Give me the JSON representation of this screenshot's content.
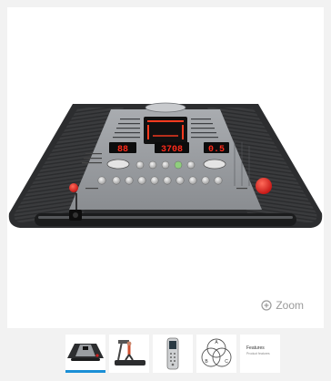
{
  "viewer": {
    "zoom_label": "Zoom",
    "zoom_icon": "zoom-icon",
    "console": {
      "left_display": "88",
      "center_display": "3708",
      "right_display": "0.5"
    }
  },
  "thumbnails": [
    {
      "name": "thumb-console",
      "active": true
    },
    {
      "name": "thumb-treadmill",
      "active": false
    },
    {
      "name": "thumb-remote",
      "active": false
    },
    {
      "name": "thumb-venn",
      "active": false,
      "letters": [
        "A",
        "B",
        "C"
      ]
    },
    {
      "name": "thumb-features",
      "active": false,
      "title": "Features",
      "subtitle": "Product features"
    }
  ],
  "colors": {
    "accent": "#1b8fd6",
    "led": "#ff2a1a",
    "background": "#f2f2f2"
  }
}
